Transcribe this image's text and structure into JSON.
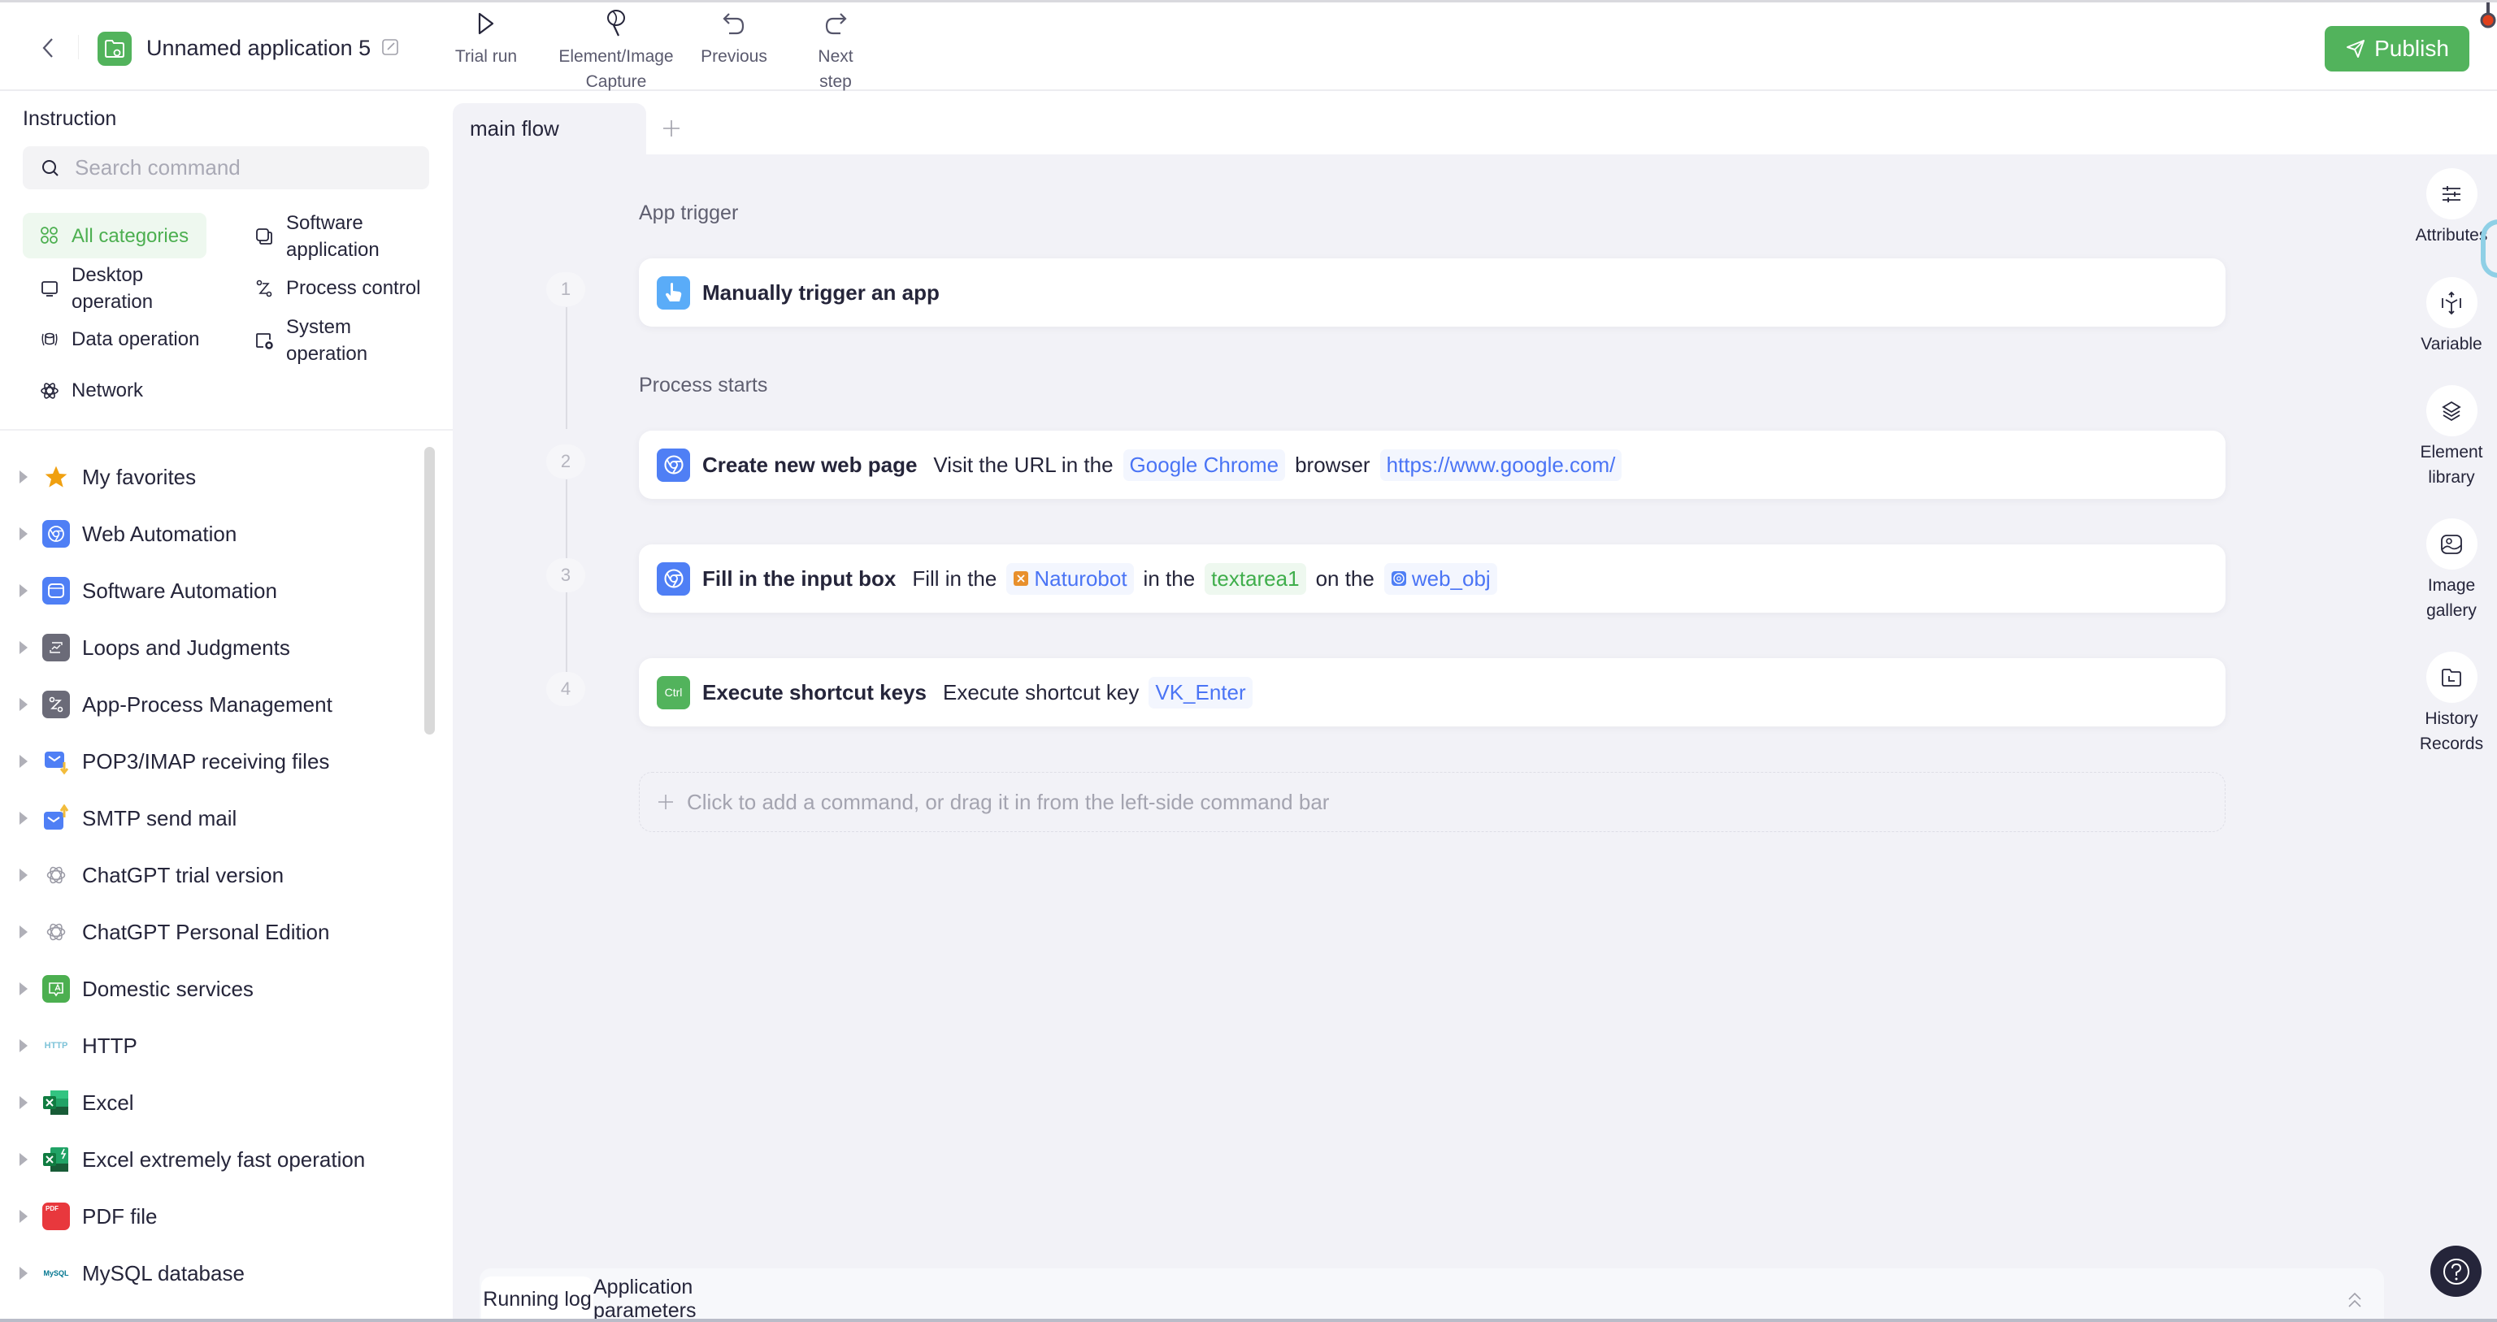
{
  "header": {
    "back_icon": "chevron-left-icon",
    "app_icon": "folder-cloud-icon",
    "app_title": "Unnamed application 5",
    "edit_icon": "edit-icon",
    "toolbar": [
      {
        "id": "trial-run",
        "icon": "play-icon",
        "label": "Trial run"
      },
      {
        "id": "element-image-capture",
        "icon": "capture-net-icon",
        "label": "Element/Image Capture"
      },
      {
        "id": "previous",
        "icon": "undo-icon",
        "label": "Previous"
      },
      {
        "id": "next-step",
        "icon": "redo-icon",
        "label": "Next step"
      }
    ],
    "publish_label": "Publish",
    "publish_icon": "send-icon",
    "accent_color": "#52b35c"
  },
  "sidebar": {
    "title": "Instruction",
    "search": {
      "placeholder": "Search command",
      "value": ""
    },
    "categories": [
      {
        "label": "All categories",
        "icon": "grid-icon",
        "active": true
      },
      {
        "label": "Software application",
        "icon": "windows-stack-icon"
      },
      {
        "label": "Desktop operation",
        "icon": "monitor-icon"
      },
      {
        "label": "Process control",
        "icon": "flow-icon"
      },
      {
        "label": "Data operation",
        "icon": "database-sync-icon"
      },
      {
        "label": "System operation",
        "icon": "system-gear-icon"
      },
      {
        "label": "Network",
        "icon": "atom-icon"
      }
    ],
    "tree": [
      {
        "label": "My favorites",
        "icon": "star-icon"
      },
      {
        "label": "Web Automation",
        "icon": "chrome-icon"
      },
      {
        "label": "Software Automation",
        "icon": "window-icon"
      },
      {
        "label": "Loops and Judgments",
        "icon": "loop-icon"
      },
      {
        "label": "App-Process Management",
        "icon": "process-icon"
      },
      {
        "label": "POP3/IMAP receiving files",
        "icon": "mail-download-icon"
      },
      {
        "label": "SMTP send mail",
        "icon": "mail-upload-icon"
      },
      {
        "label": "ChatGPT trial version",
        "icon": "openai-icon"
      },
      {
        "label": "ChatGPT Personal Edition",
        "icon": "openai-icon"
      },
      {
        "label": "Domestic services",
        "icon": "translate-chat-icon"
      },
      {
        "label": "HTTP",
        "icon": "http-icon",
        "icon_text": "HTTP"
      },
      {
        "label": "Excel",
        "icon": "excel-icon"
      },
      {
        "label": "Excel extremely fast operation",
        "icon": "excel-fast-icon"
      },
      {
        "label": "PDF file",
        "icon": "pdf-icon",
        "icon_text": "PDF"
      },
      {
        "label": "MySQL database",
        "icon": "mysql-icon",
        "icon_text": "MySQL"
      }
    ]
  },
  "tabs": [
    {
      "label": "main flow",
      "active": true
    }
  ],
  "flow": {
    "trigger_section": "App trigger",
    "process_section": "Process starts",
    "steps": [
      {
        "number": "1",
        "icon": "hand-pointer-icon",
        "title": "Manually trigger an app",
        "parts": []
      },
      {
        "number": "2",
        "icon": "chrome-icon",
        "title": "Create new web page",
        "parts": [
          {
            "type": "text",
            "value": "Visit the URL in the"
          },
          {
            "type": "chip",
            "value": "Google Chrome"
          },
          {
            "type": "text",
            "value": "browser"
          },
          {
            "type": "chip",
            "value": "https://www.google.com/"
          }
        ]
      },
      {
        "number": "3",
        "icon": "chrome-icon",
        "title": "Fill in the input box",
        "parts": [
          {
            "type": "text",
            "value": "Fill in the"
          },
          {
            "type": "chip",
            "value": "Naturobot",
            "icon": "variable-x-icon"
          },
          {
            "type": "text",
            "value": "in the"
          },
          {
            "type": "chip-green",
            "value": "textarea1"
          },
          {
            "type": "text",
            "value": "on the"
          },
          {
            "type": "chip",
            "value": "web_obj",
            "icon": "chrome-small-icon"
          }
        ]
      },
      {
        "number": "4",
        "icon": "ctrl-key-icon",
        "icon_text": "Ctrl",
        "title": "Execute shortcut keys",
        "parts": [
          {
            "type": "text",
            "value": "Execute shortcut key"
          },
          {
            "type": "chip",
            "value": "VK_Enter"
          }
        ]
      }
    ],
    "add_command": "Click to add a command, or drag it in from the left-side command bar"
  },
  "right_rail": [
    {
      "label": "Attributes",
      "icon": "sliders-icon"
    },
    {
      "label": "Variable",
      "icon": "cube-icon"
    },
    {
      "label": "Element library",
      "icon": "layers-icon"
    },
    {
      "label": "Image gallery",
      "icon": "image-icon"
    },
    {
      "label": "History Records",
      "icon": "history-folder-icon"
    }
  ],
  "bottom_panel": {
    "tabs": [
      {
        "label": "Running log",
        "active": true
      },
      {
        "label": "Application parameters",
        "active": false
      }
    ],
    "collapse_icon": "double-chevron-up-icon",
    "help_icon": "help-icon"
  }
}
